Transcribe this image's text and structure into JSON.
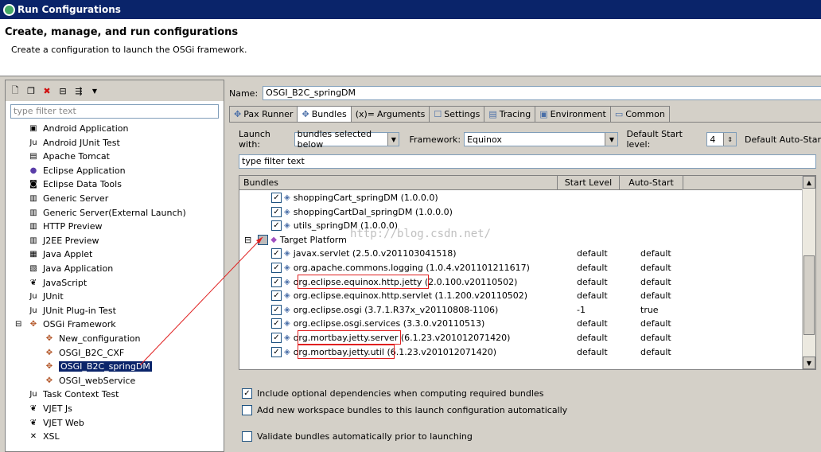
{
  "window": {
    "title": "Run Configurations"
  },
  "header": {
    "title": "Create, manage, and run configurations",
    "subtitle": "Create a configuration to launch the OSGi framework."
  },
  "left": {
    "filter_placeholder": "type filter text",
    "tree": [
      {
        "label": "Android Application",
        "icon": "android-app-icon"
      },
      {
        "label": "Android JUnit Test",
        "icon": "junit-icon"
      },
      {
        "label": "Apache Tomcat",
        "icon": "tomcat-icon"
      },
      {
        "label": "Eclipse Application",
        "icon": "eclipse-icon"
      },
      {
        "label": "Eclipse Data Tools",
        "icon": "database-icon"
      },
      {
        "label": "Generic Server",
        "icon": "server-icon"
      },
      {
        "label": "Generic Server(External Launch)",
        "icon": "server-icon"
      },
      {
        "label": "HTTP Preview",
        "icon": "server-icon"
      },
      {
        "label": "J2EE Preview",
        "icon": "server-icon"
      },
      {
        "label": "Java Applet",
        "icon": "applet-icon"
      },
      {
        "label": "Java Application",
        "icon": "java-app-icon"
      },
      {
        "label": "JavaScript",
        "icon": "javascript-icon"
      },
      {
        "label": "JUnit",
        "icon": "junit-icon"
      },
      {
        "label": "JUnit Plug-in Test",
        "icon": "junit-icon"
      },
      {
        "label": "OSGi Framework",
        "icon": "osgi-icon",
        "expanded": true
      },
      {
        "label": "New_configuration",
        "icon": "osgi-icon",
        "child": true
      },
      {
        "label": "OSGI_B2C_CXF",
        "icon": "osgi-icon",
        "child": true
      },
      {
        "label": "OSGI_B2C_springDM",
        "icon": "osgi-icon",
        "child": true,
        "selected": true
      },
      {
        "label": "OSGI_webService",
        "icon": "osgi-icon",
        "child": true
      },
      {
        "label": "Task Context Test",
        "icon": "junit-icon"
      },
      {
        "label": "VJET Js",
        "icon": "vjet-icon"
      },
      {
        "label": "VJET Web",
        "icon": "vjet-icon"
      },
      {
        "label": "XSL",
        "icon": "xsl-icon"
      }
    ]
  },
  "right": {
    "name_label": "Name:",
    "name_value": "OSGI_B2C_springDM",
    "tabs": [
      "Pax Runner",
      "Bundles",
      "Arguments",
      "Settings",
      "Tracing",
      "Environment",
      "Common"
    ],
    "tab_prefix": "(x)=",
    "launch_with_label": "Launch with:",
    "launch_with_value": "bundles selected below",
    "framework_label": "Framework:",
    "framework_value": "Equinox",
    "default_start_label": "Default Start level:",
    "default_start_value": "4",
    "default_auto_label": "Default Auto-Star",
    "filter_text": "type filter text",
    "columns": [
      "Bundles",
      "Start Level",
      "Auto-Start"
    ],
    "workspace_rows": [
      {
        "name": "shoppingCart_springDM (1.0.0.0)"
      },
      {
        "name": "shoppingCartDal_springDM (1.0.0.0)"
      },
      {
        "name": "utils_springDM (1.0.0.0)"
      }
    ],
    "target_label": "Target Platform",
    "watermark": "http://blog.csdn.net/",
    "target_rows": [
      {
        "name": "javax.servlet (2.5.0.v201103041518)",
        "level": "default",
        "auto": "default"
      },
      {
        "name": "org.apache.commons.logging (1.0.4.v201101211617)",
        "level": "default",
        "auto": "default"
      },
      {
        "name": "org.eclipse.equinox.http.jetty (2.0.100.v20110502)",
        "level": "default",
        "auto": "default"
      },
      {
        "name": "org.eclipse.equinox.http.servlet (1.1.200.v20110502)",
        "level": "default",
        "auto": "default"
      },
      {
        "name": "org.eclipse.osgi (3.7.1.R37x_v20110808-1106)",
        "level": "-1",
        "auto": "true"
      },
      {
        "name": "org.eclipse.osgi.services (3.3.0.v20110513)",
        "level": "default",
        "auto": "default"
      },
      {
        "name": "org.mortbay.jetty.server (6.1.23.v201012071420)",
        "level": "default",
        "auto": "default"
      },
      {
        "name": "org.mortbay.jetty.util (6.1.23.v201012071420)",
        "level": "default",
        "auto": "default"
      }
    ],
    "options": [
      {
        "label": "Include optional dependencies when computing required bundles",
        "checked": true
      },
      {
        "label": "Add new workspace bundles to this launch configuration automatically",
        "checked": false
      },
      {
        "label": "Validate bundles automatically prior to launching",
        "checked": false
      }
    ]
  },
  "colors": {
    "titlebar": "#0a246a",
    "selection": "#0a246a",
    "highlight_box": "#e02020"
  }
}
